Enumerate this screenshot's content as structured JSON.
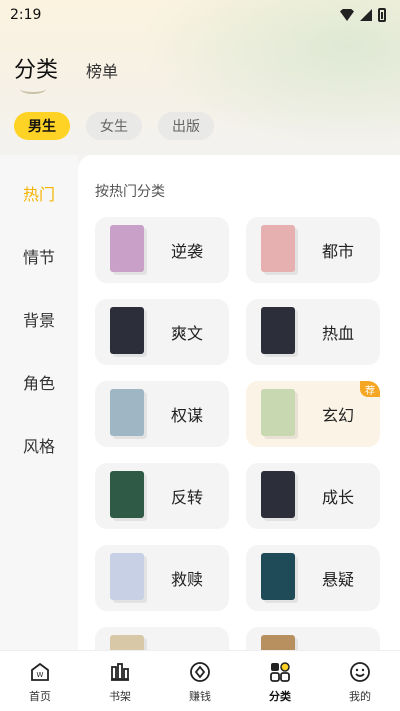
{
  "status": {
    "time": "2:19"
  },
  "top_tabs": [
    {
      "label": "分类"
    },
    {
      "label": "榜单"
    }
  ],
  "gender_tabs": [
    {
      "label": "男生",
      "active": true
    },
    {
      "label": "女生"
    },
    {
      "label": "出版"
    }
  ],
  "sidebar": {
    "items": [
      {
        "label": "热门",
        "active": true
      },
      {
        "label": "情节"
      },
      {
        "label": "背景"
      },
      {
        "label": "角色"
      },
      {
        "label": "风格"
      }
    ]
  },
  "panel": {
    "title": "按热门分类",
    "cards": [
      {
        "label": "逆袭",
        "cover": "#c9a0c8"
      },
      {
        "label": "都市",
        "cover": "#e6b0b0"
      },
      {
        "label": "爽文",
        "cover": "#2c2f3a"
      },
      {
        "label": "热血",
        "cover": "#2c2f3a"
      },
      {
        "label": "权谋",
        "cover": "#9fb6c4"
      },
      {
        "label": "玄幻",
        "cover": "#c8d8b0",
        "badge": "荐"
      },
      {
        "label": "反转",
        "cover": "#2f5a45"
      },
      {
        "label": "成长",
        "cover": "#2c2f3a"
      },
      {
        "label": "救赎",
        "cover": "#c8d0e6"
      },
      {
        "label": "悬疑",
        "cover": "#1f4a58"
      }
    ]
  },
  "bottom_nav": [
    {
      "label": "首页",
      "icon": "home-icon"
    },
    {
      "label": "书架",
      "icon": "bookshelf-icon"
    },
    {
      "label": "赚钱",
      "icon": "earn-icon"
    },
    {
      "label": "分类",
      "icon": "category-icon",
      "active": true
    },
    {
      "label": "我的",
      "icon": "profile-icon"
    }
  ]
}
